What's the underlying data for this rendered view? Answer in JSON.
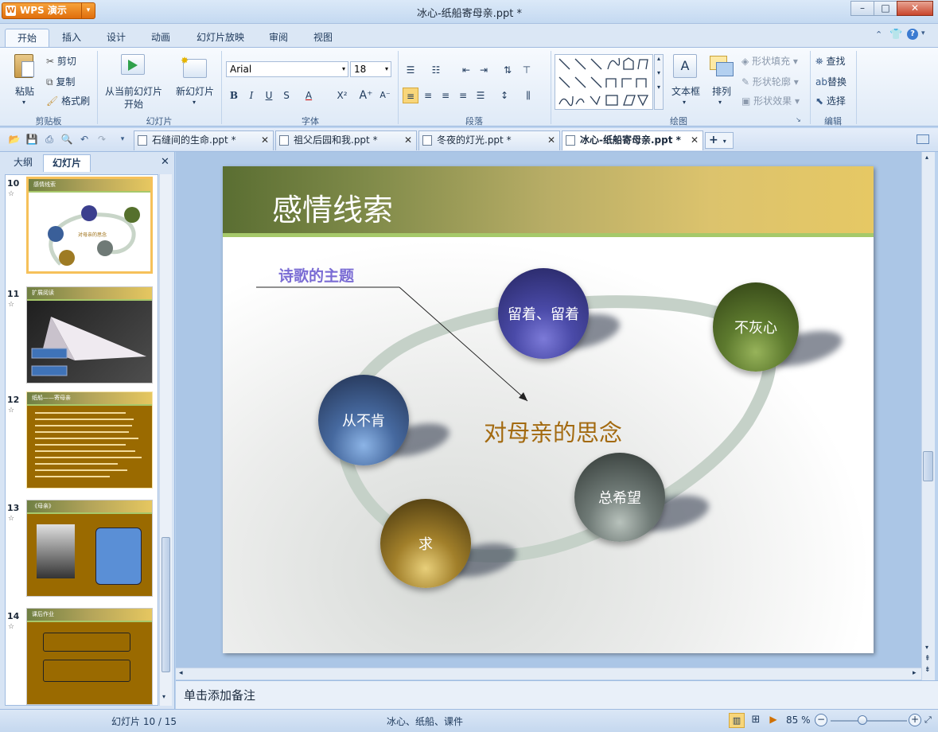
{
  "app": {
    "logo_label": "WPS 演示",
    "window_title": "冰心-纸船寄母亲.ppt *"
  },
  "ribbon_tabs": [
    "开始",
    "插入",
    "设计",
    "动画",
    "幻灯片放映",
    "审阅",
    "视图"
  ],
  "ribbon": {
    "clipboard": {
      "paste": "粘贴",
      "cut": "剪切",
      "copy": "复制",
      "format_painter": "格式刷",
      "group": "剪贴板"
    },
    "slides": {
      "from_current": "从当前幻灯片",
      "from_current_2": "开始",
      "new_slide": "新幻灯片",
      "group": "幻灯片"
    },
    "font": {
      "name": "Arial",
      "size": "18",
      "group": "字体"
    },
    "paragraph": {
      "group": "段落"
    },
    "drawing": {
      "textbox": "文本框",
      "arrange": "排列",
      "shape_fill": "形状填充",
      "shape_outline": "形状轮廓",
      "shape_effect": "形状效果",
      "group": "绘图"
    },
    "editing": {
      "find": "查找",
      "replace": "替换",
      "select": "选择",
      "group": "编辑"
    }
  },
  "doc_tabs": [
    {
      "label": "石缝间的生命.ppt *"
    },
    {
      "label": "祖父后园和我.ppt *"
    },
    {
      "label": "冬夜的灯光.ppt *"
    },
    {
      "label": "冰心-纸船寄母亲.ppt *"
    }
  ],
  "panel": {
    "tab_outline": "大纲",
    "tab_slides": "幻灯片"
  },
  "thumbnails": [
    {
      "num": "10",
      "title": "感情线索",
      "selected": true
    },
    {
      "num": "11",
      "title": "扩展阅读"
    },
    {
      "num": "12",
      "title": "纸船——寄母亲"
    },
    {
      "num": "13",
      "title": "《母亲》"
    },
    {
      "num": "14",
      "title": "课后作业"
    }
  ],
  "slide": {
    "title": "感情线索",
    "subtitle": "诗歌的主题",
    "center_text": "对母亲的思念",
    "spheres": [
      "留着、留着",
      "不灰心",
      "从不肯",
      "总希望",
      "求"
    ]
  },
  "notes_placeholder": "单击添加备注",
  "status": {
    "slide_counter": "幻灯片 10 / 15",
    "keywords": "冰心、纸船、课件",
    "zoom": "85 %"
  }
}
